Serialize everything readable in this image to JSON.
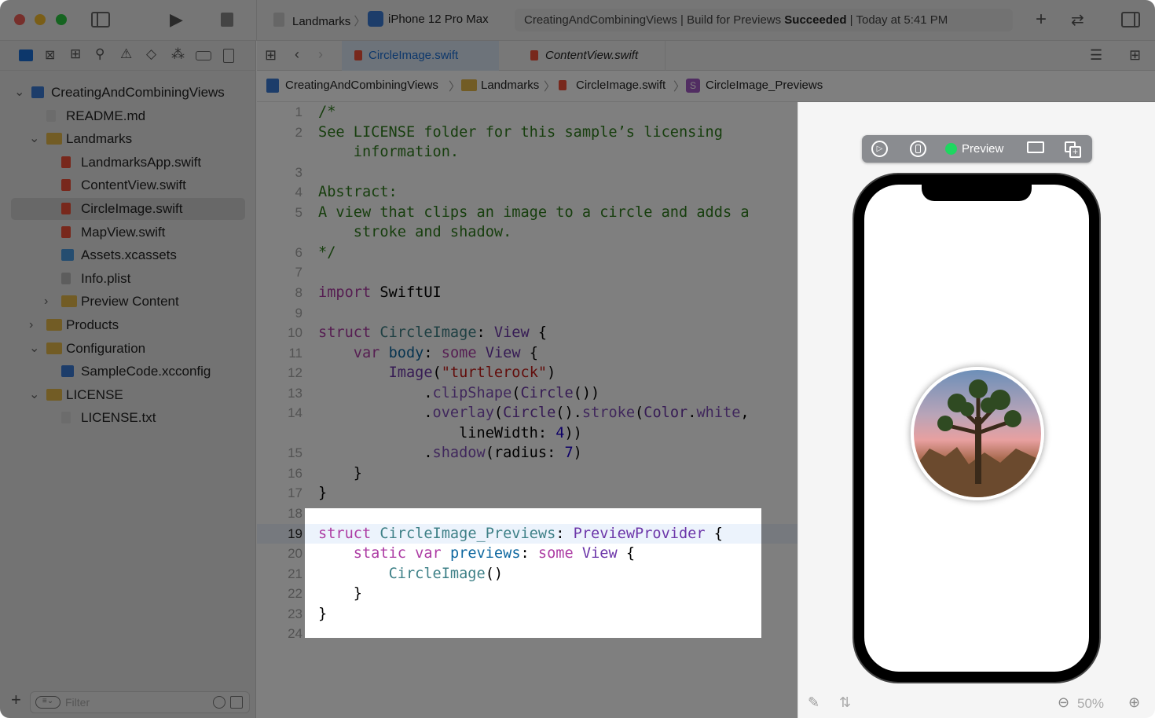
{
  "toolbar": {
    "scheme": "Landmarks",
    "device": "iPhone 12 Pro Max",
    "status_project": "CreatingAndCombiningViews",
    "status_action": "Build for Previews",
    "status_result": "Succeeded",
    "status_time": "Today at 5:41 PM"
  },
  "tabs": [
    {
      "label": "CircleImage.swift",
      "active": true
    },
    {
      "label": "ContentView.swift",
      "active": false
    }
  ],
  "breadcrumb": [
    "CreatingAndCombiningViews",
    "Landmarks",
    "CircleImage.swift",
    "CircleImage_Previews"
  ],
  "sidebar": {
    "filter_placeholder": "Filter",
    "items": [
      {
        "label": "CreatingAndCombiningViews",
        "depth": 0,
        "icon": "project",
        "chevron": "open"
      },
      {
        "label": "README.md",
        "depth": 1,
        "icon": "doc"
      },
      {
        "label": "Landmarks",
        "depth": 1,
        "icon": "folder",
        "chevron": "open"
      },
      {
        "label": "LandmarksApp.swift",
        "depth": 2,
        "icon": "swift"
      },
      {
        "label": "ContentView.swift",
        "depth": 2,
        "icon": "swift"
      },
      {
        "label": "CircleImage.swift",
        "depth": 2,
        "icon": "swift",
        "selected": true
      },
      {
        "label": "MapView.swift",
        "depth": 2,
        "icon": "swift"
      },
      {
        "label": "Assets.xcassets",
        "depth": 2,
        "icon": "assets"
      },
      {
        "label": "Info.plist",
        "depth": 2,
        "icon": "plist"
      },
      {
        "label": "Preview Content",
        "depth": 2,
        "icon": "folder",
        "chevron": "closed"
      },
      {
        "label": "Products",
        "depth": 1,
        "icon": "folder",
        "chevron": "closed"
      },
      {
        "label": "Configuration",
        "depth": 1,
        "icon": "folder",
        "chevron": "open"
      },
      {
        "label": "SampleCode.xcconfig",
        "depth": 2,
        "icon": "config"
      },
      {
        "label": "LICENSE",
        "depth": 1,
        "icon": "folder",
        "chevron": "open"
      },
      {
        "label": "LICENSE.txt",
        "depth": 2,
        "icon": "doc"
      }
    ]
  },
  "code": [
    {
      "n": "1",
      "t": [
        [
          "/*",
          "c"
        ]
      ]
    },
    {
      "n": "2",
      "t": [
        [
          "See LICENSE folder for this sample’s licensing",
          "c"
        ]
      ]
    },
    {
      "n": "",
      "t": [
        [
          "    information.",
          "c"
        ]
      ]
    },
    {
      "n": "3",
      "t": []
    },
    {
      "n": "4",
      "t": [
        [
          "Abstract:",
          "c"
        ]
      ]
    },
    {
      "n": "5",
      "t": [
        [
          "A view that clips an image to a circle and adds a",
          "c"
        ]
      ]
    },
    {
      "n": "",
      "t": [
        [
          "    stroke and shadow.",
          "c"
        ]
      ]
    },
    {
      "n": "6",
      "t": [
        [
          "*/",
          "c"
        ]
      ]
    },
    {
      "n": "7",
      "t": []
    },
    {
      "n": "8",
      "t": [
        [
          "import",
          "k"
        ],
        [
          " SwiftUI",
          "p"
        ]
      ]
    },
    {
      "n": "9",
      "t": []
    },
    {
      "n": "10",
      "t": [
        [
          "struct",
          "k"
        ],
        [
          " ",
          "p"
        ],
        [
          "CircleImage",
          "pt"
        ],
        [
          ": ",
          "p"
        ],
        [
          "View",
          "st"
        ],
        [
          " {",
          "p"
        ]
      ]
    },
    {
      "n": "11",
      "t": [
        [
          "    ",
          "p"
        ],
        [
          "var",
          "k"
        ],
        [
          " ",
          "p"
        ],
        [
          "body",
          "d"
        ],
        [
          ": ",
          "p"
        ],
        [
          "some",
          "k"
        ],
        [
          " ",
          "p"
        ],
        [
          "View",
          "st"
        ],
        [
          " {",
          "p"
        ]
      ]
    },
    {
      "n": "12",
      "t": [
        [
          "        ",
          "p"
        ],
        [
          "Image",
          "st"
        ],
        [
          "(",
          "p"
        ],
        [
          "\"turtlerock\"",
          "s"
        ],
        [
          ")",
          "p"
        ]
      ]
    },
    {
      "n": "13",
      "t": [
        [
          "            .",
          "p"
        ],
        [
          "clipShape",
          "pm"
        ],
        [
          "(",
          "p"
        ],
        [
          "Circle",
          "st"
        ],
        [
          "())",
          "p"
        ]
      ]
    },
    {
      "n": "14",
      "t": [
        [
          "            .",
          "p"
        ],
        [
          "overlay",
          "pm"
        ],
        [
          "(",
          "p"
        ],
        [
          "Circle",
          "st"
        ],
        [
          "().",
          "p"
        ],
        [
          "stroke",
          "pm"
        ],
        [
          "(",
          "p"
        ],
        [
          "Color",
          "st"
        ],
        [
          ".",
          "p"
        ],
        [
          "white",
          "pm"
        ],
        [
          ",",
          "p"
        ]
      ]
    },
    {
      "n": "",
      "t": [
        [
          "                lineWidth: ",
          "p"
        ],
        [
          "4",
          "n"
        ],
        [
          "))",
          "p"
        ]
      ]
    },
    {
      "n": "15",
      "t": [
        [
          "            .",
          "p"
        ],
        [
          "shadow",
          "pm"
        ],
        [
          "(radius: ",
          "p"
        ],
        [
          "7",
          "n"
        ],
        [
          ")",
          "p"
        ]
      ]
    },
    {
      "n": "16",
      "t": [
        [
          "    }",
          "p"
        ]
      ]
    },
    {
      "n": "17",
      "t": [
        [
          "}",
          "p"
        ]
      ]
    },
    {
      "n": "18",
      "t": []
    },
    {
      "n": "19",
      "t": [
        [
          "struct",
          "k"
        ],
        [
          " ",
          "p"
        ],
        [
          "CircleImage_Previews",
          "pt"
        ],
        [
          ": ",
          "p"
        ],
        [
          "PreviewProvider",
          "st"
        ],
        [
          " {",
          "p"
        ]
      ],
      "current": true
    },
    {
      "n": "20",
      "t": [
        [
          "    ",
          "p"
        ],
        [
          "static",
          "k"
        ],
        [
          " ",
          "p"
        ],
        [
          "var",
          "k"
        ],
        [
          " ",
          "p"
        ],
        [
          "previews",
          "d"
        ],
        [
          ": ",
          "p"
        ],
        [
          "some",
          "k"
        ],
        [
          " ",
          "p"
        ],
        [
          "View",
          "st"
        ],
        [
          " {",
          "p"
        ]
      ]
    },
    {
      "n": "21",
      "t": [
        [
          "        ",
          "p"
        ],
        [
          "CircleImage",
          "pt"
        ],
        [
          "()",
          "p"
        ]
      ]
    },
    {
      "n": "22",
      "t": [
        [
          "    }",
          "p"
        ]
      ]
    },
    {
      "n": "23",
      "t": [
        [
          "}",
          "p"
        ]
      ]
    },
    {
      "n": "24",
      "t": []
    }
  ],
  "preview": {
    "label": "Preview",
    "status_color": "#1ed760",
    "zoom": "50%"
  },
  "colors": {
    "accent": "#1a6fd6",
    "dim_overlay": "rgba(0,0,0,0.5)"
  }
}
